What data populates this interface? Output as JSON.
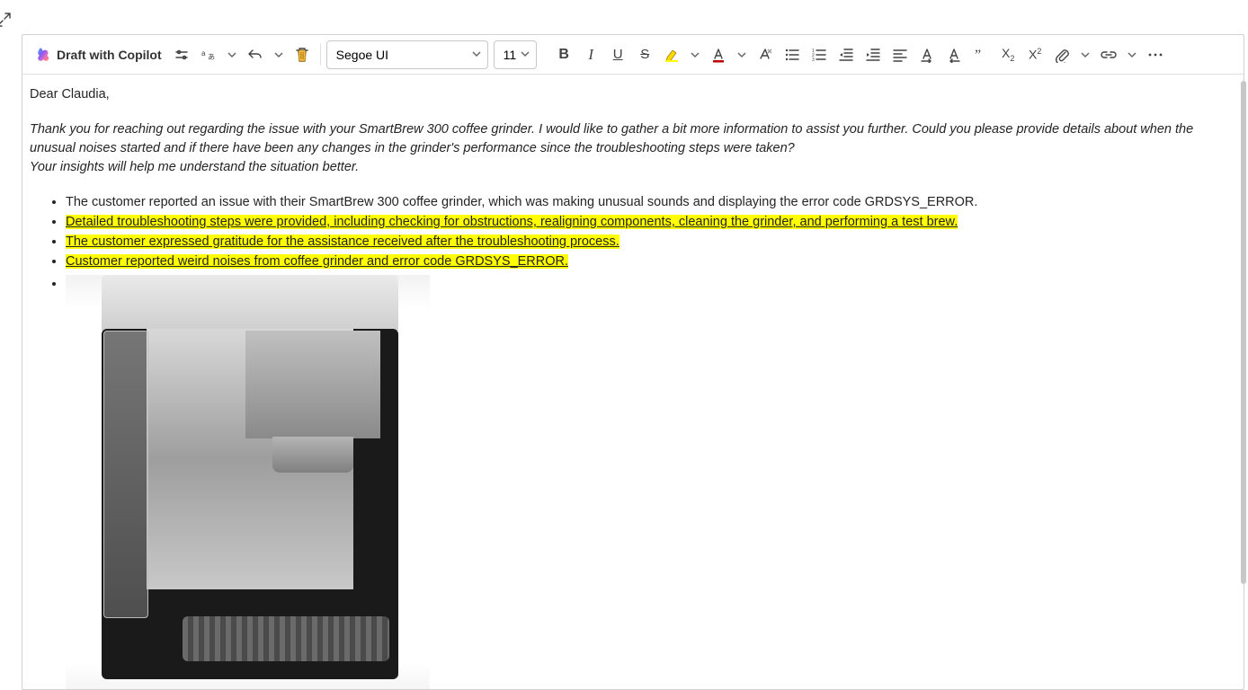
{
  "toolbar": {
    "copilot_label": "Draft with Copilot",
    "font_name": "Segoe UI",
    "font_size": "11"
  },
  "body": {
    "greeting": "Dear Claudia,",
    "intro_line1": "Thank you for reaching out regarding the issue with your SmartBrew 300 coffee grinder. I would like to gather a bit more information to assist you further. Could you please provide details about when the unusual noises started and if there have been any changes in the grinder's performance since the troubleshooting steps were taken?",
    "intro_line2": "Your insights will help me understand the situation better.",
    "bullets": [
      {
        "text": "The customer reported an issue with their SmartBrew 300 coffee grinder, which was making unusual sounds and displaying the error code GRDSYS_ERROR.",
        "highlight": false
      },
      {
        "text": "Detailed troubleshooting steps were provided, including checking for obstructions, realigning components, cleaning the grinder, and performing a test brew.",
        "highlight": true
      },
      {
        "text": "The customer expressed gratitude for the assistance received after the troubleshooting process.",
        "highlight": true
      },
      {
        "text": "Customer reported weird noises from coffee grinder and error code GRDSYS_ERROR.",
        "highlight": true
      }
    ]
  },
  "colors": {
    "highlight": "#ffff00",
    "font_color_swatch": "#c00000",
    "highlight_swatch": "#ffff00"
  }
}
